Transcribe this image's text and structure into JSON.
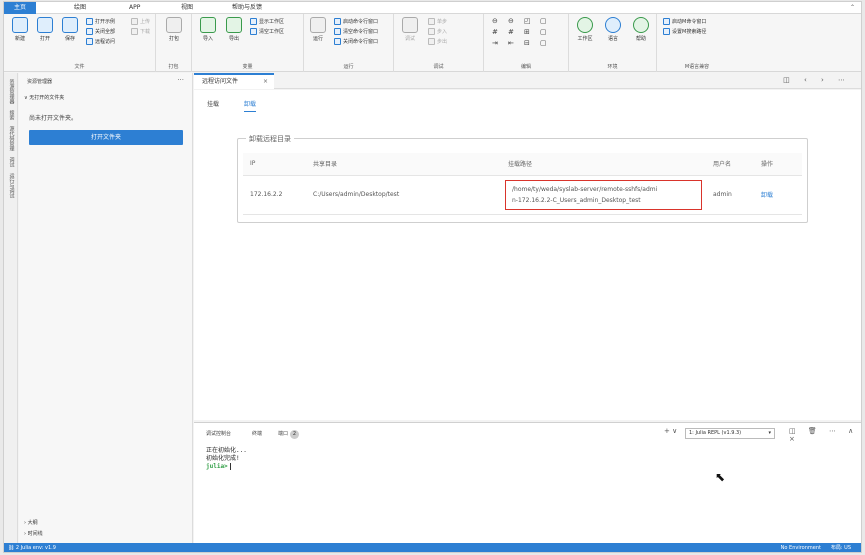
{
  "ribbon_tabs": [
    "主页",
    "绘图",
    "APP",
    "视图",
    "帮助与反馈"
  ],
  "ribbon": {
    "file": {
      "label": "文件",
      "new": "新建",
      "open": "打开",
      "save": "保存",
      "open_example": "打开示例",
      "close_all": "关闭全部",
      "remote_access": "远程访问",
      "up": "上传",
      "down": "下载"
    },
    "package": {
      "label": "打包",
      "pack": "打包"
    },
    "variables": {
      "label": "变量",
      "import": "导入",
      "export": "导出",
      "show_workspace": "显示工作区",
      "clear_workspace": "清空工作区"
    },
    "run": {
      "label": "运行",
      "run": "运行",
      "start_cmd": "启动命令行窗口",
      "clear_cmd": "清空命令行窗口",
      "close_cmd": "关闭命令行窗口"
    },
    "debug": {
      "label": "调试",
      "debug": "调试",
      "step": "单步",
      "step_in": "步入",
      "step_out": "步出"
    },
    "edit": {
      "label": "编辑"
    },
    "env": {
      "label": "环境",
      "repo": "工作区",
      "lang": "语言",
      "help": "帮助"
    },
    "m_compat": {
      "label": "M语言兼容",
      "start_m": "启动M命令窗口",
      "set_m_path": "设置M搜索路径"
    }
  },
  "activity_bar": [
    "资源管理器",
    "搜索",
    "源代码管理",
    "调试",
    "运行与调试"
  ],
  "sidebar": {
    "title": "资源管理器",
    "more": "···",
    "section": "无打开的文件夹",
    "empty_text": "尚未打开文件夹。",
    "open_folder_button": "打开文件夹",
    "footer": [
      "大纲",
      "时间线"
    ]
  },
  "editor_tab": {
    "title": "远程访问文件",
    "close": "×"
  },
  "editor_icons": "◫ ‹ › ⋯",
  "subtabs": [
    "挂载",
    "卸载"
  ],
  "fieldset_title": "卸载远程目录",
  "table": {
    "headers": [
      "IP",
      "共享目录",
      "挂载路径",
      "用户名",
      "操作"
    ],
    "rows": [
      {
        "ip": "172.16.2.2",
        "share": "C:/Users/admin/Desktop/test",
        "mount_line1": "/home/ty/weda/syslab-server/remote-sshfs/admi",
        "mount_line2": "n-172.16.2.2-C_Users_admin_Desktop_test",
        "user": "admin",
        "action": "卸载"
      }
    ]
  },
  "panel": {
    "tabs": [
      "调试控制台",
      "终端",
      "端口"
    ],
    "ports_badge": "2",
    "repl_select": "1: Julia REPL (v1.9.3)",
    "repl_caret": "▾",
    "add_icon": "+ ∨",
    "tools": "◫ 🗑 ⋯ ∧ ×",
    "lines": [
      "正在初始化...",
      "初始化完成!"
    ],
    "prompt": "julia>"
  },
  "status_bar": {
    "left": "⛓ 2  Julia env: v1.9",
    "right": "No Environment",
    "lang": "布局: US"
  },
  "colors": {
    "accent": "#2d7fd3",
    "highlight_border": "#d9342b",
    "prompt": "#2f9e44"
  }
}
